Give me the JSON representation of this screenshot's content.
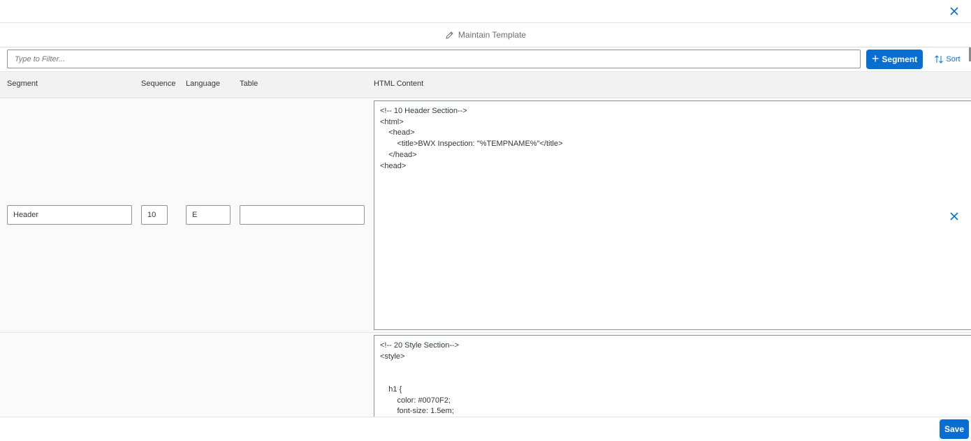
{
  "dialog": {
    "title": "Maintain Template",
    "close_icon": "close-icon",
    "title_icon": "pencil-icon"
  },
  "toolbar": {
    "filter_placeholder": "Type to Filter...",
    "filter_value": "",
    "add_segment_label": "Segment",
    "sort_label": "Sort"
  },
  "table": {
    "columns": [
      "Segment",
      "Sequence",
      "Language",
      "Table",
      "HTML Content"
    ],
    "rows": [
      {
        "segment": "Header",
        "sequence": "10",
        "language": "E",
        "table": "",
        "html": "<!-- 10 Header Section-->\n<html>\n    <head>\n        <title>BWX Inspection: \"%TEMPNAME%\"</title>\n    </head>\n<head>"
      },
      {
        "segment": "",
        "sequence": "",
        "language": "",
        "table": "",
        "html": "<!-- 20 Style Section-->\n<style>\n\n\n    h1 {\n        color: #0070F2;\n        font-size: 1.5em;"
      }
    ]
  },
  "footer": {
    "save_label": "Save"
  },
  "colors": {
    "accent": "#0a6ed1",
    "header_bg": "#f2f2f2",
    "row_bg": "#fafafa"
  }
}
